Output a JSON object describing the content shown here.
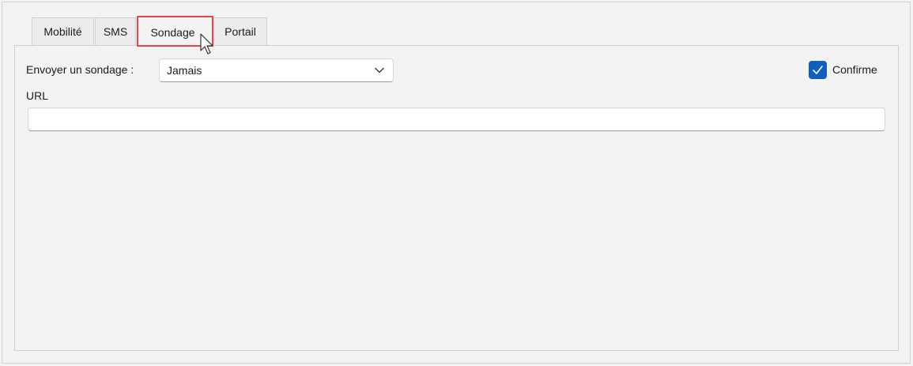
{
  "tabs": [
    {
      "label": "Mobilité",
      "selected": false
    },
    {
      "label": "SMS",
      "selected": false
    },
    {
      "label": "Sondage",
      "selected": true
    },
    {
      "label": "Portail",
      "selected": false
    }
  ],
  "form": {
    "send_survey_label": "Envoyer un sondage :",
    "send_survey_value": "Jamais",
    "url_label": "URL",
    "url_value": "",
    "confirm_label": "Confirme",
    "confirm_checked": true
  },
  "colors": {
    "accent": "#0f5fbf",
    "highlight": "#e0474c",
    "background": "#f3f3f3"
  },
  "icons": {
    "dropdown": "chevron-down-icon",
    "checkbox": "checkmark-icon",
    "cursor": "mouse-pointer-icon"
  }
}
